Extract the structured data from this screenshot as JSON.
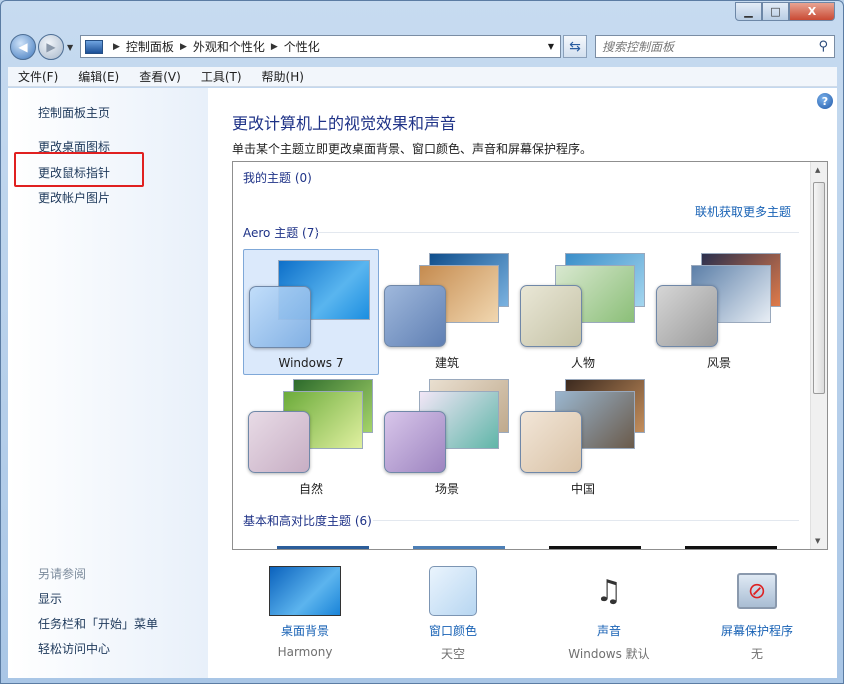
{
  "window": {
    "min_icon": "minimize-icon",
    "max_icon": "maximize-icon",
    "close_label": "X"
  },
  "nav": {
    "breadcrumb": [
      "控制面板",
      "外观和个性化",
      "个性化"
    ],
    "search_placeholder": "搜索控制面板"
  },
  "menu": [
    "文件(F)",
    "编辑(E)",
    "查看(V)",
    "工具(T)",
    "帮助(H)"
  ],
  "sidebar": {
    "links": [
      "控制面板主页",
      "更改桌面图标",
      "更改鼠标指针",
      "更改帐户图片"
    ],
    "see_also_title": "另请参阅",
    "see_also": [
      "显示",
      "任务栏和「开始」菜单",
      "轻松访问中心"
    ]
  },
  "main": {
    "title": "更改计算机上的视觉效果和声音",
    "subtitle": "单击某个主题立即更改桌面背景、窗口颜色、声音和屏幕保护程序。",
    "my_themes": "我的主题 (0)",
    "online_link": "联机获取更多主题",
    "aero_themes": "Aero 主题 (7)",
    "basic_themes": "基本和高对比度主题 (6)",
    "themes": [
      {
        "name": "Windows 7",
        "selected": true
      },
      {
        "name": "建筑"
      },
      {
        "name": "人物"
      },
      {
        "name": "风景"
      },
      {
        "name": "自然"
      },
      {
        "name": "场景"
      },
      {
        "name": "中国"
      }
    ]
  },
  "bottom": [
    {
      "link": "桌面背景",
      "value": "Harmony"
    },
    {
      "link": "窗口颜色",
      "value": "天空"
    },
    {
      "link": "声音",
      "value": "Windows 默认"
    },
    {
      "link": "屏幕保护程序",
      "value": "无"
    }
  ],
  "colors": {
    "link": "#1862b5",
    "title": "#1e3287",
    "highlight": "#e02020"
  }
}
